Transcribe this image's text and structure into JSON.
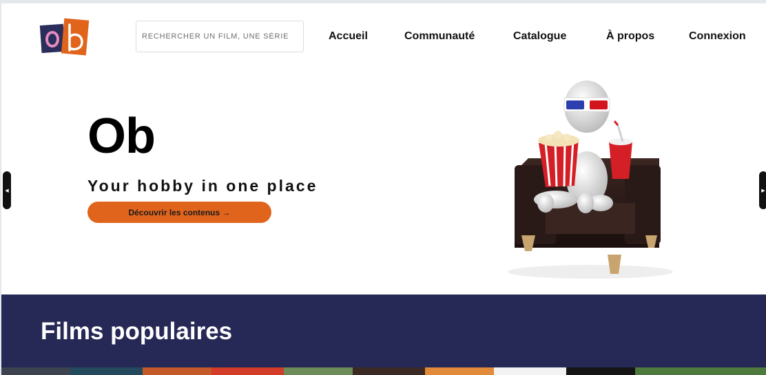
{
  "header": {
    "search": {
      "placeholder": "RECHERCHER UN FILM, UNE SÉRIE",
      "value": ""
    },
    "nav": [
      {
        "label": "Accueil"
      },
      {
        "label": "Communauté"
      },
      {
        "label": "Catalogue"
      },
      {
        "label": "À propos"
      },
      {
        "label": "Connexion"
      }
    ]
  },
  "logo": {
    "text": "ob",
    "colors": {
      "o_bg": "#2b2d5a",
      "o_fg": "#e58bc0",
      "b_bg": "#e0641c",
      "b_fg": "#ffffff"
    }
  },
  "hero": {
    "title": "Ob",
    "tagline": "Your hobby in one place",
    "cta_label": "Découvrir les contenus →",
    "prev_icon": "caret-left-icon",
    "next_icon": "caret-right-icon",
    "illustration": "3d-figure-in-armchair-with-popcorn-and-3d-glasses"
  },
  "popular": {
    "title": "Films populaires"
  },
  "colors": {
    "accent": "#e0641c",
    "band": "#262856",
    "text": "#111111"
  }
}
